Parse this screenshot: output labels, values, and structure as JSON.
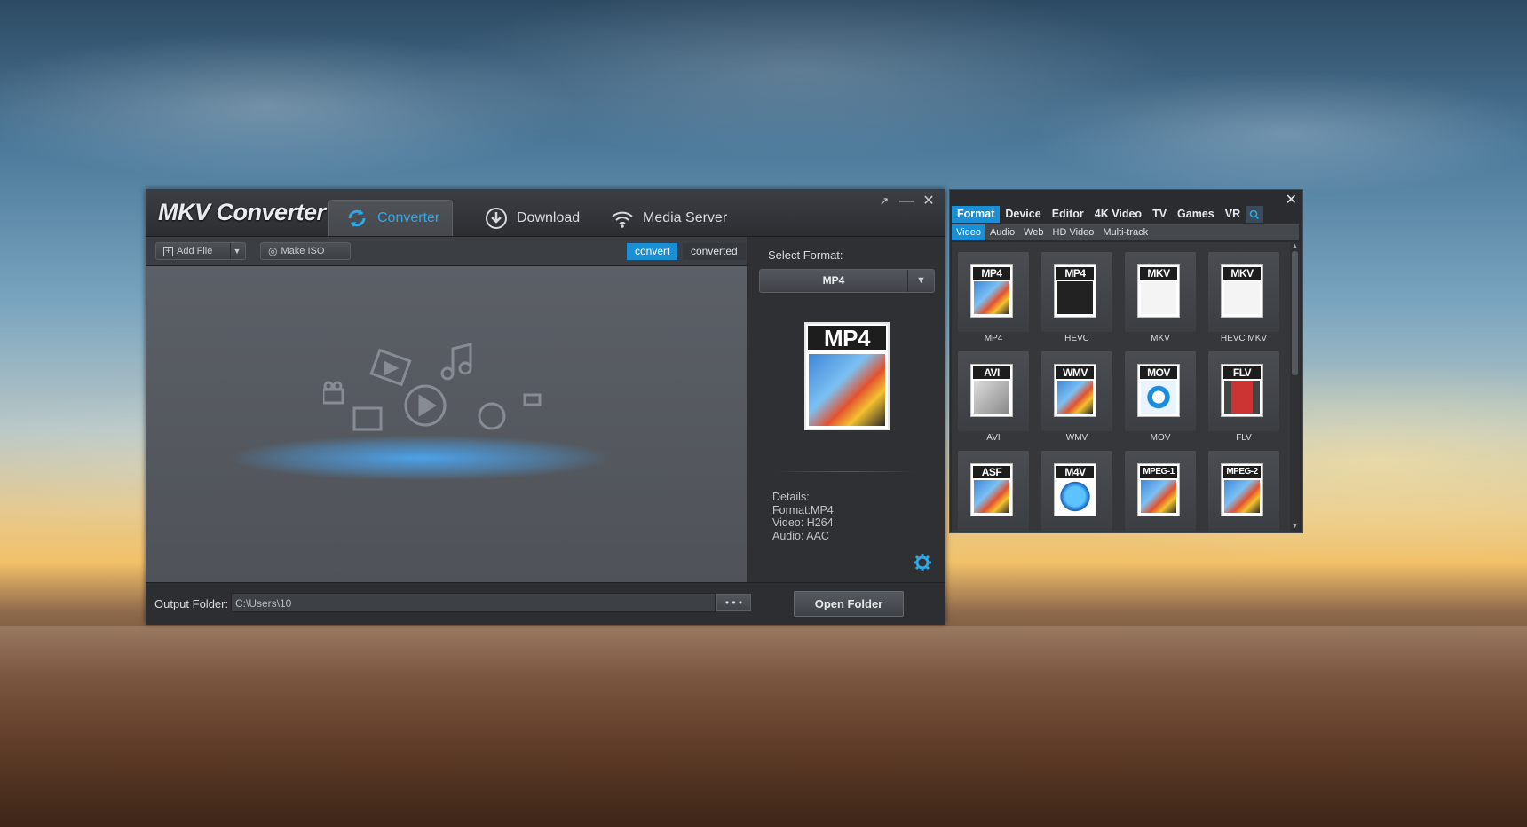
{
  "app": {
    "title": "MKV Converter",
    "tabs": [
      {
        "label": "Converter",
        "icon": "refresh-icon",
        "active": true
      },
      {
        "label": "Download",
        "icon": "download-icon",
        "active": false
      },
      {
        "label": "Media Server",
        "icon": "wifi-icon",
        "active": false
      }
    ]
  },
  "toolbar": {
    "add_file": "Add File",
    "make_iso": "Make ISO",
    "segment": {
      "convert": "convert",
      "converted": "converted"
    }
  },
  "right_panel": {
    "select_format_label": "Select Format:",
    "selected_format": "MP4",
    "preview_icon_label": "MP4",
    "details": [
      "Details:",
      "Format:MP4",
      "Video: H264",
      "Audio: AAC"
    ]
  },
  "bottom": {
    "output_folder_label": "Output Folder:",
    "output_path": "C:\\Users\\10",
    "browse_label": "• • •",
    "open_folder": "Open Folder"
  },
  "format_window": {
    "close": "✕",
    "tabs": [
      "Format",
      "Device",
      "Editor",
      "4K Video",
      "TV",
      "Games",
      "VR"
    ],
    "sub_tabs": [
      "Video",
      "Audio",
      "Web",
      "HD Video",
      "Multi-track"
    ],
    "tiles": [
      {
        "icon_text": "MP4",
        "label": "MP4"
      },
      {
        "icon_text": "MP4",
        "label": "HEVC"
      },
      {
        "icon_text": "MKV",
        "label": "MKV"
      },
      {
        "icon_text": "MKV",
        "label": "HEVC MKV"
      },
      {
        "icon_text": "AVI",
        "label": "AVI"
      },
      {
        "icon_text": "WMV",
        "label": "WMV"
      },
      {
        "icon_text": "MOV",
        "label": "MOV"
      },
      {
        "icon_text": "FLV",
        "label": "FLV"
      },
      {
        "icon_text": "ASF",
        "label": ""
      },
      {
        "icon_text": "M4V",
        "label": ""
      },
      {
        "icon_text": "MPEG-1",
        "label": ""
      },
      {
        "icon_text": "MPEG-2",
        "label": ""
      }
    ]
  },
  "colors": {
    "accent": "#1a8fd6",
    "tab_active_text": "#2fa8e8"
  }
}
